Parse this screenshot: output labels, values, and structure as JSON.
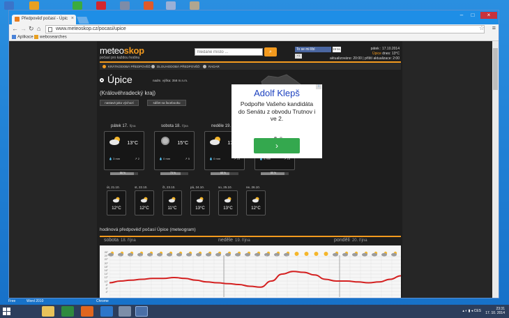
{
  "browser": {
    "tab_title": "Předpověď počasí - Úpic",
    "url": "www.meteoskop.cz/pocasi/upice",
    "bookmarks": [
      "Aplikace",
      "webosearches"
    ]
  },
  "site": {
    "logo_main": "meteo",
    "logo_accent": "skop",
    "tagline": "počasí pro každou hodinu",
    "search_placeholder": "hledané místo ...",
    "fb_like": "To se mi líbí",
    "fb_count": "19 tis.",
    "gplus": "+1",
    "date_line": "pátek : 17.10.2014",
    "now_place": "Úpice",
    "now_label": "dnes:",
    "now_temp": "13°C",
    "updated": "aktualizováno: 20:00 | příští aktualizace: 2:00",
    "nav": [
      "KRÁTKODOBÁ PŘEDPOVĚĎ",
      "DLOUHODOBÁ PŘEDPOVĚĎ",
      "RADAR"
    ],
    "city": "Úpice",
    "altitude": "nadm. výška: 358 m.n.m.",
    "region": "(Královéhradecký kraj)",
    "btn_home": "nastavit jako výchozí",
    "btn_fb": "sdílet na facebooku",
    "map_link": "vyhl. ČR"
  },
  "ad": {
    "title": "Adolf Klepš",
    "body": "Podpořte Vašeho kandidáta do Senátu z obvodu Trutnov i ve 2.",
    "button": "›",
    "badge": "i"
  },
  "days": [
    {
      "name": "pátek 17.",
      "month": "října",
      "temp": "13°C",
      "rain": "3 mm",
      "wind": "2",
      "bar": "86 %",
      "fill": 0.86,
      "icon": "cloud-sun-icon"
    },
    {
      "name": "sobota 18.",
      "month": "října",
      "temp": "15°C",
      "rain": "0 mm",
      "wind": "5",
      "bar": "73 %",
      "fill": 0.73,
      "icon": "fog-icon"
    },
    {
      "name": "neděle 19.",
      "month": "října",
      "temp": "17°C",
      "rain": "0 mm",
      "wind": "15",
      "bar": "68 %",
      "fill": 0.68,
      "icon": "cloud-sun-icon"
    },
    {
      "name": "pondělí 20.",
      "month": "října",
      "temp": "16°C",
      "rain": "4 mm",
      "wind": "15",
      "bar": "85 %",
      "fill": 0.85,
      "icon": "cloud-sun-icon"
    }
  ],
  "mini_days": [
    {
      "name": "út, 21.10.",
      "temp": "12°C"
    },
    {
      "name": "st, 22.10.",
      "temp": "12°C"
    },
    {
      "name": "čt, 23.10.",
      "temp": "11°C"
    },
    {
      "name": "pá, 24.10.",
      "temp": "13°C"
    },
    {
      "name": "so, 25.10.",
      "temp": "13°C"
    },
    {
      "name": "ne, 26.10.",
      "temp": "12°C"
    }
  ],
  "meteogram": {
    "title": "hodinová předpověď počasí Úpice (meteogram)",
    "days": [
      {
        "name": "sobota",
        "date": "18. října"
      },
      {
        "name": "neděle",
        "date": "19. října"
      },
      {
        "name": "pondělí",
        "date": "20. října"
      }
    ],
    "y_ticks": [
      "26°",
      "24°",
      "22°",
      "20°",
      "18°",
      "16°",
      "14°",
      "12°",
      "10°",
      "8°",
      "6°",
      "4°"
    ],
    "temps": [
      11,
      12,
      12.5,
      13,
      13.5,
      13.5,
      14,
      13.5,
      12.5,
      11.5,
      11,
      10.5,
      10,
      9,
      8.5,
      12,
      16,
      17.5,
      17,
      15.5,
      13,
      12,
      12,
      11.5,
      11,
      11.5,
      13,
      15
    ]
  },
  "taskbar": {
    "time": "23:31",
    "date": "17. 10. 2014",
    "lang": "CES"
  },
  "desktop": [
    "Free",
    "Word 2010",
    "Chrome"
  ]
}
